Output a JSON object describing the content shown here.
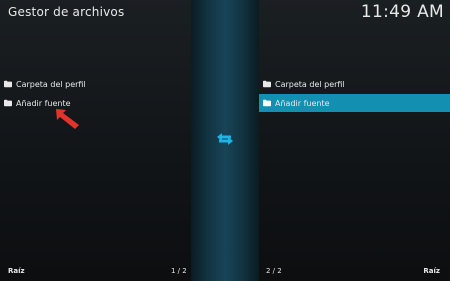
{
  "header": {
    "title": "Gestor de archivos",
    "clock": "11:49 AM"
  },
  "left_panel": {
    "items": [
      {
        "label": "Carpeta del perfil",
        "icon": "folder-icon"
      },
      {
        "label": "Añadir fuente",
        "icon": "folder-icon"
      }
    ],
    "footer_label": "Raíz",
    "page": "1 / 2"
  },
  "right_panel": {
    "items": [
      {
        "label": "Carpeta del perfil",
        "icon": "folder-icon"
      },
      {
        "label": "Añadir fuente",
        "icon": "folder-icon",
        "selected": true
      }
    ],
    "footer_label": "Raíz",
    "page": "2 / 2"
  },
  "center": {
    "icon": "swap-arrows-icon"
  },
  "colors": {
    "accent": "#138fb1",
    "swap_icon": "#1fb3e6",
    "pointer_arrow": "#e0352b"
  }
}
